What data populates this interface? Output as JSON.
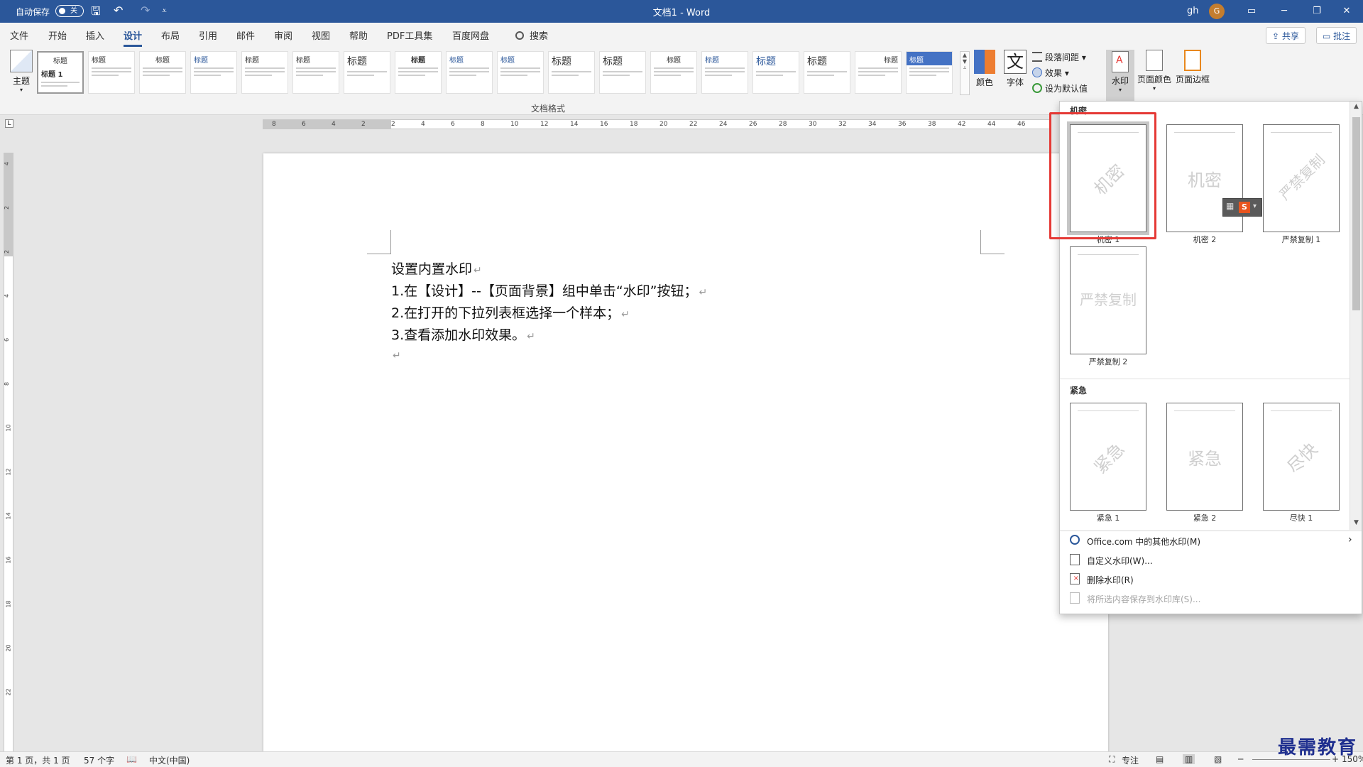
{
  "titlebar": {
    "autosave_label": "自动保存",
    "autosave_state": "关",
    "doc_title": "文档1 - Word",
    "user_name": "gh",
    "avatar_initial": "G"
  },
  "tabs": {
    "items": [
      "文件",
      "开始",
      "插入",
      "设计",
      "布局",
      "引用",
      "邮件",
      "审阅",
      "视图",
      "帮助",
      "PDF工具集",
      "百度网盘"
    ],
    "active": "设计",
    "search_label": "搜索",
    "share_label": "共享",
    "comment_label": "批注"
  },
  "ribbon": {
    "theme_label": "主题",
    "style_headings": [
      "标题 1",
      "标题",
      "标题",
      "标题",
      "标题",
      "标题",
      "标题",
      "标题",
      "标题",
      "标题",
      "标题",
      "标题",
      "标题",
      "标题",
      "标题",
      "标题",
      "标题",
      "标题"
    ],
    "group_label_doc_format": "文档格式",
    "colors_label": "颜色",
    "fonts_label": "字体",
    "fonts_glyph": "文",
    "para_spacing_label": "段落间距",
    "effects_label": "效果",
    "set_default_label": "设为默认值",
    "watermark_label": "水印",
    "page_color_label": "页面颜色",
    "page_border_label": "页面边框"
  },
  "ruler": {
    "h_ticks": [
      "8",
      "6",
      "4",
      "2",
      "2",
      "4",
      "6",
      "8",
      "10",
      "12",
      "14",
      "16",
      "18",
      "20",
      "22",
      "24",
      "26",
      "28",
      "30",
      "32",
      "34",
      "36",
      "38",
      "42",
      "44",
      "46"
    ],
    "v_ticks": [
      "4",
      "2",
      "2",
      "4",
      "6",
      "8",
      "10",
      "12",
      "14",
      "16",
      "18",
      "20",
      "22"
    ]
  },
  "document": {
    "lines": [
      "设置内置水印",
      "1.在【设计】--【页面背景】组中单击“水印”按钮；",
      "2.在打开的下拉列表框选择一个样本；",
      "3.查看添加水印效果。",
      ""
    ],
    "para_mark": "↵"
  },
  "watermark_panel": {
    "sections": [
      {
        "title": "机密",
        "items": [
          {
            "text": "机密",
            "caption": "机密 1",
            "diagonal": true
          },
          {
            "text": "机密",
            "caption": "机密 2",
            "diagonal": false
          },
          {
            "text": "严禁复制",
            "caption": "严禁复制 1",
            "diagonal": true
          },
          {
            "text": "严禁复制",
            "caption": "严禁复制 2",
            "diagonal": false
          }
        ]
      },
      {
        "title": "紧急",
        "items": [
          {
            "text": "紧急",
            "caption": "紧急 1",
            "diagonal": true
          },
          {
            "text": "紧急",
            "caption": "紧急 2",
            "diagonal": false
          },
          {
            "text": "尽快",
            "caption": "尽快 1",
            "diagonal": true
          }
        ]
      }
    ],
    "menu": [
      {
        "label": "Office.com 中的其他水印(M)",
        "disabled": false,
        "has_submenu": true
      },
      {
        "label": "自定义水印(W)...",
        "disabled": false,
        "has_submenu": false
      },
      {
        "label": "删除水印(R)",
        "disabled": false,
        "has_submenu": false
      },
      {
        "label": "将所选内容保存到水印库(S)...",
        "disabled": true,
        "has_submenu": false
      }
    ],
    "highlight_color": "#e53935"
  },
  "statusbar": {
    "page_info": "第 1 页，共 1 页",
    "word_count": "57 个字",
    "language": "中文(中国)",
    "focus_label": "专注",
    "zoom": "150%"
  },
  "brand": "最需教育",
  "colors": {
    "accent": "#2b579a",
    "title_bg": "#2b579a"
  }
}
